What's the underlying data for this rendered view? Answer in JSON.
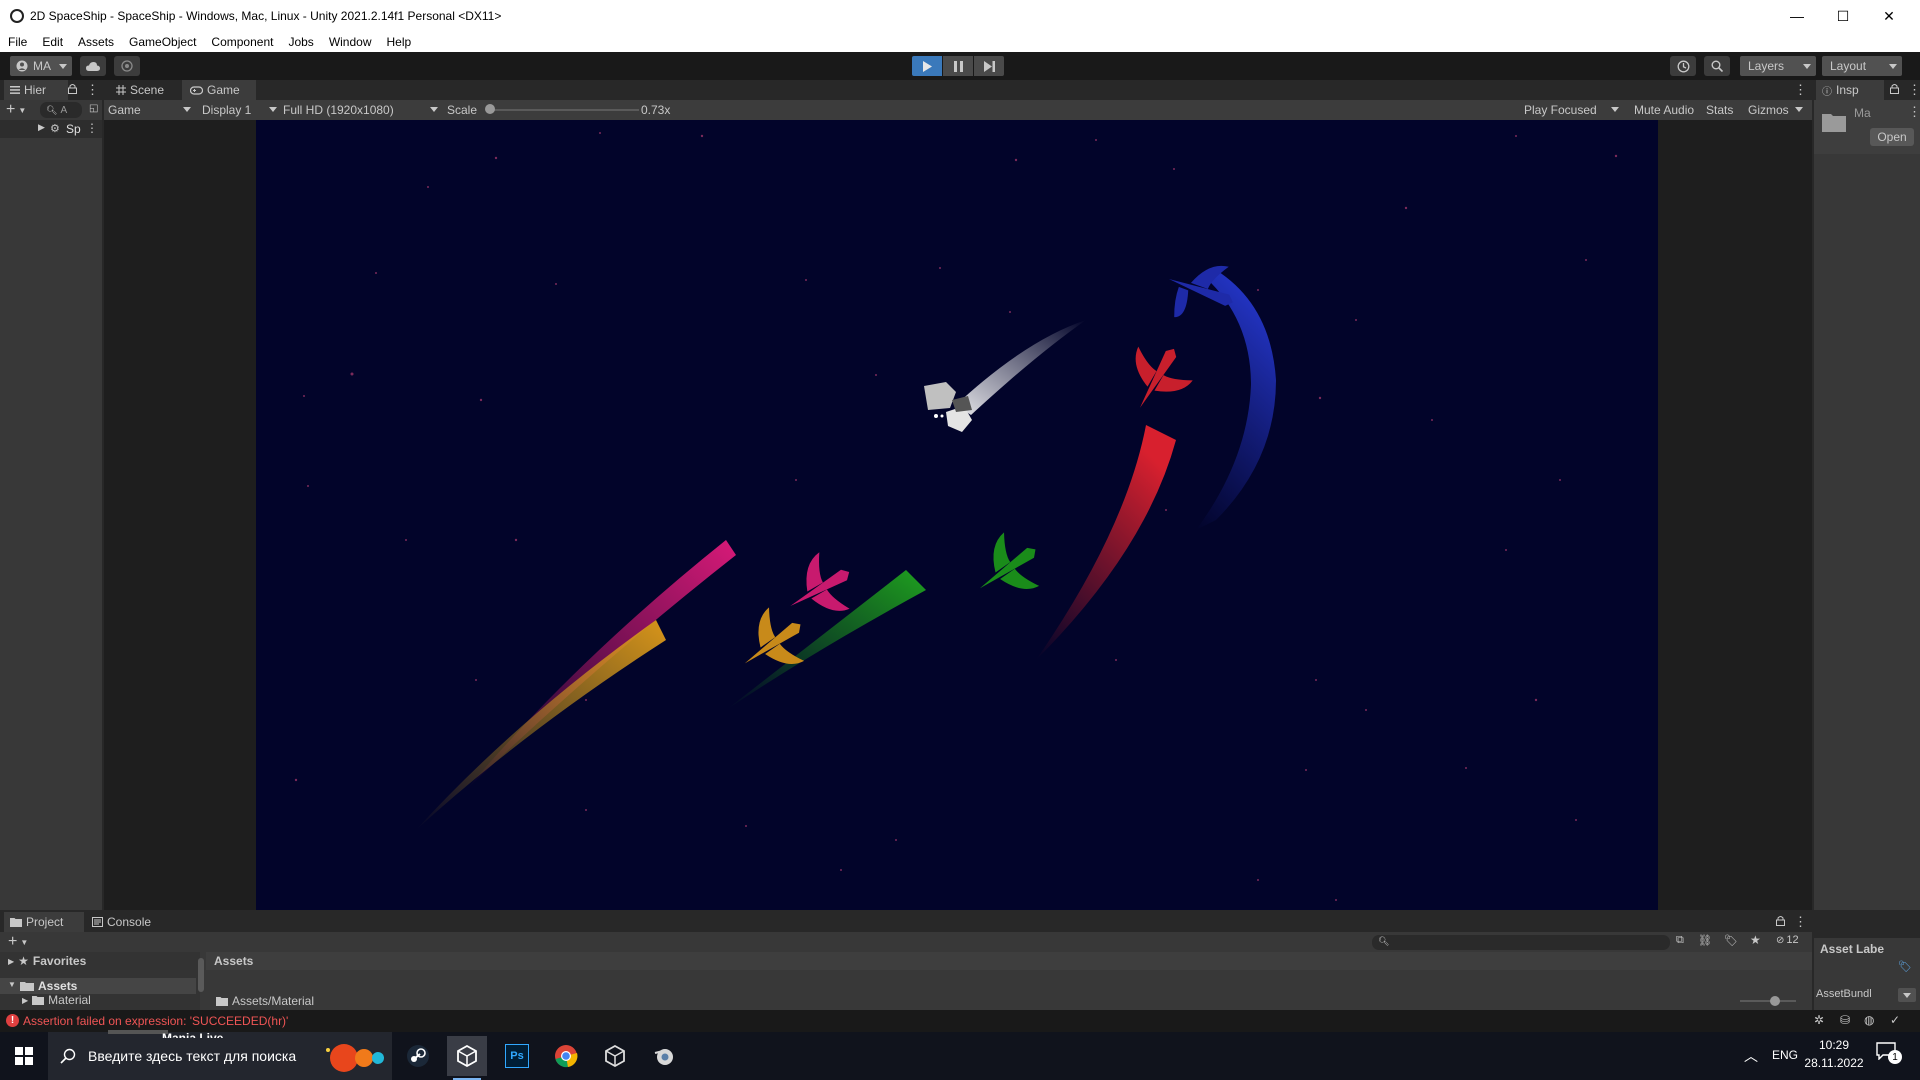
{
  "window": {
    "title": "2D SpaceShip - SpaceShip - Windows, Mac, Linux - Unity 2021.2.14f1 Personal <DX11>",
    "controls": {
      "minimize": "—",
      "maximize": "☐",
      "close": "✕"
    }
  },
  "menu": [
    "File",
    "Edit",
    "Assets",
    "GameObject",
    "Component",
    "Jobs",
    "Window",
    "Help"
  ],
  "toolbar": {
    "account": "MA",
    "layers": "Layers",
    "layout": "Layout",
    "play_state": "playing"
  },
  "hierarchy": {
    "tab": "Hier",
    "search_placeholder": "A",
    "scene_item": "Sp"
  },
  "scene_tabs": [
    {
      "label": "Scene",
      "icon": "grid-icon",
      "active": false
    },
    {
      "label": "Game",
      "icon": "gamepad-icon",
      "active": true
    }
  ],
  "game_bar": {
    "view_mode": "Game",
    "display": "Display 1",
    "resolution": "Full HD (1920x1080)",
    "scale_label": "Scale",
    "scale_value": "0.73x",
    "scale_fraction": 0.0,
    "play_focused": "Play Focused",
    "mute_audio": "Mute Audio",
    "stats": "Stats",
    "gizmos": "Gizmos"
  },
  "inspector": {
    "tab": "Insp",
    "object_name": "Ma",
    "open_button": "Open",
    "asset_labels": "Asset Labe",
    "asset_bundle": "AssetBundl"
  },
  "project": {
    "tabs": [
      {
        "label": "Project",
        "active": true
      },
      {
        "label": "Console",
        "active": false
      }
    ],
    "favorites": "Favorites",
    "assets_root": "Assets",
    "material_folder": "Material",
    "breadcrumb": "Assets",
    "path_item": "Assets/Material",
    "hidden_count": "12",
    "search_value": ""
  },
  "status": {
    "error_message": "Assertion failed on expression: 'SUCCEEDED(hr)'",
    "error_color": "#f05555"
  },
  "taskbar": {
    "search_placeholder": "Введите здесь текст для поиска",
    "apps": [
      "steam",
      "unity-hub",
      "photoshop",
      "chrome",
      "unity",
      "blender"
    ],
    "ps_label": "Ps",
    "language": "ENG",
    "time": "10:29",
    "date": "28.11.2022",
    "notification_count": "1"
  },
  "partial_text": {
    "cut_line": "Mania Live"
  },
  "colors": {
    "game_bg": "#02042a",
    "ship_blue": "#1e2aa8",
    "ship_red": "#c81f2c",
    "ship_green": "#1a8c1a",
    "ship_pink": "#c81a6e",
    "ship_gold": "#c88a1a"
  }
}
